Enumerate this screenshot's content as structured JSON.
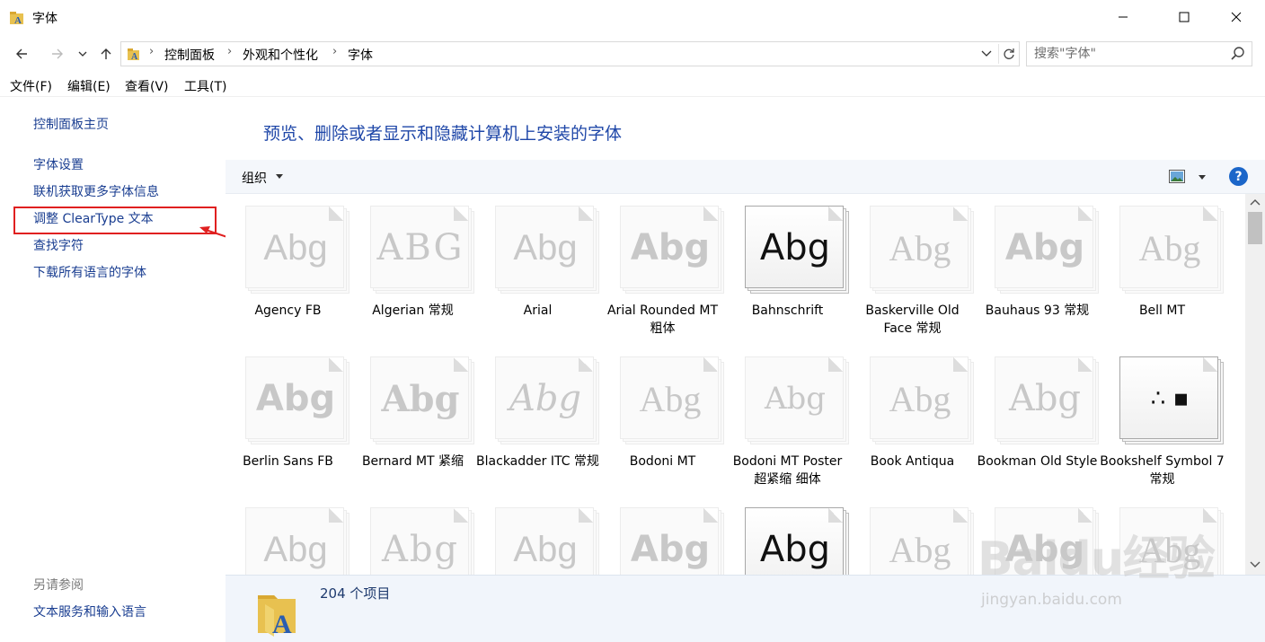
{
  "window": {
    "title": "字体",
    "controls": {
      "minimize_icon": "minimize-icon",
      "maximize_icon": "maximize-icon",
      "close_icon": "close-icon"
    }
  },
  "address_bar": {
    "crumbs": [
      "控制面板",
      "外观和个性化",
      "字体"
    ],
    "search_placeholder": "搜索\"字体\""
  },
  "menu": [
    "文件(F)",
    "编辑(E)",
    "查看(V)",
    "工具(T)"
  ],
  "sidebar": {
    "home": "控制面板主页",
    "links": [
      "字体设置",
      "联机获取更多字体信息",
      "调整 ClearType 文本",
      "查找字符",
      "下载所有语言的字体"
    ],
    "see_also_title": "另请参阅",
    "see_also_links": [
      "文本服务和输入语言"
    ]
  },
  "content": {
    "heading": "预览、删除或者显示和隐藏计算机上安装的字体",
    "toolbar": {
      "organize": "组织",
      "help": "?"
    },
    "fonts": [
      {
        "name": "Agency FB",
        "sample": "Abg"
      },
      {
        "name": "Algerian 常规",
        "sample": "ABG"
      },
      {
        "name": "Arial",
        "sample": "Abg"
      },
      {
        "name": "Arial Rounded MT 粗体",
        "sample": "Abg"
      },
      {
        "name": "Bahnschrift",
        "sample": "Abg"
      },
      {
        "name": "Baskerville Old Face 常规",
        "sample": "Abg"
      },
      {
        "name": "Bauhaus 93 常规",
        "sample": "Abg"
      },
      {
        "name": "Bell MT",
        "sample": "Abg"
      },
      {
        "name": "Berlin Sans FB",
        "sample": "Abg"
      },
      {
        "name": "Bernard MT 紧缩",
        "sample": "Abg"
      },
      {
        "name": "Blackadder ITC 常规",
        "sample": "Abg"
      },
      {
        "name": "Bodoni MT",
        "sample": "Abg"
      },
      {
        "name": "Bodoni MT Poster 超紧缩 细体",
        "sample": "Abg"
      },
      {
        "name": "Book Antiqua",
        "sample": "Abg"
      },
      {
        "name": "Bookman Old Style",
        "sample": "Abg"
      },
      {
        "name": "Bookshelf Symbol 7 常规",
        "sample": "∴ ▪"
      }
    ],
    "partial_row_samples": [
      "Abg",
      "Abg",
      "Abg",
      "Abg",
      "Abg",
      "Abg",
      "Abg",
      "Abg"
    ]
  },
  "details": {
    "count": "204 个项目"
  },
  "watermark": {
    "logo": "Baidu经验",
    "url": "jingyan.baidu.com"
  },
  "colors": {
    "link": "#1a3e91",
    "heading": "#1f47a8",
    "highlight": "#e02020",
    "status_bg": "#f1f5fb"
  }
}
